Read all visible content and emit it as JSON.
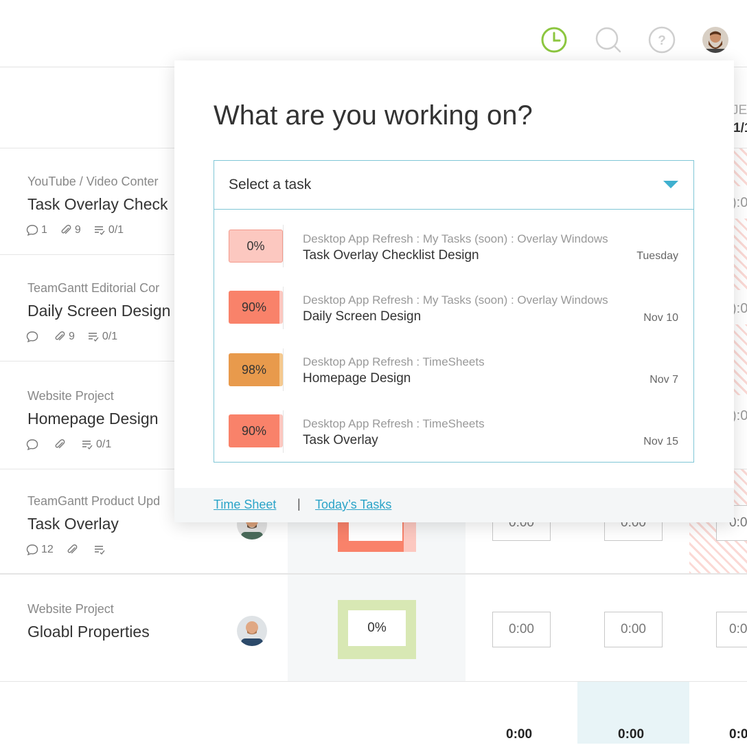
{
  "header": {
    "icons": [
      "clock-icon",
      "search-icon",
      "help-icon"
    ],
    "help_glyph": "?",
    "accent_color": "#8cc63f"
  },
  "rows": [
    {
      "project": "YouTube / Video Conter",
      "title": "Task Overlay Check",
      "comments": "1",
      "attachments": "9",
      "checklist": "0/1"
    },
    {
      "project": "TeamGantt Editorial Cor",
      "title": "Daily Screen Design",
      "comments": "",
      "attachments": "9",
      "checklist": "0/1"
    },
    {
      "project": "Website Project",
      "title": "Homepage Design",
      "comments": "",
      "attachments": "",
      "checklist": "0/1"
    },
    {
      "project": "TeamGantt Product Upd",
      "title": "Task Overlay",
      "comments": "12",
      "attachments": "",
      "checklist": "",
      "progress": "90%",
      "times": [
        "0:00",
        "0:00",
        "0:0"
      ]
    },
    {
      "project": "Website Project",
      "title": "Gloabl Properties",
      "progress": "0%",
      "times": [
        "0:00",
        "0:00",
        "0:0"
      ]
    }
  ],
  "grid_edge": {
    "header_fragment_1": "JE",
    "header_fragment_2": "1/1",
    "cell_fragment": "):0"
  },
  "totals": [
    "0:00",
    "0:00",
    "0:0"
  ],
  "overlay": {
    "title": "What are you working on?",
    "select_placeholder": "Select a task",
    "tasks": [
      {
        "percent": "0%",
        "path": "Desktop App Refresh : My Tasks (soon) : Overlay Windows",
        "name": "Task Overlay Checklist Design",
        "date": "Tuesday",
        "color": "#fcc8c0",
        "border": "#f39a8c"
      },
      {
        "percent": "90%",
        "path": "Desktop App Refresh : My Tasks (soon) : Overlay Windows",
        "name": "Daily Screen Design",
        "date": "Nov 10",
        "color": "#f9826a",
        "border": "#f9826a"
      },
      {
        "percent": "98%",
        "path": "Desktop App Refresh : TimeSheets",
        "name": "Homepage Design",
        "date": "Nov 7",
        "color": "#e89a4c",
        "border": "#e89a4c"
      },
      {
        "percent": "90%",
        "path": "Desktop App Refresh : TimeSheets",
        "name": "Task Overlay",
        "date": "Nov 15",
        "color": "#f9826a",
        "border": "#f9826a"
      }
    ],
    "footer": {
      "time_sheet": "Time Sheet",
      "separator": "|",
      "todays_tasks": "Today’s Tasks"
    }
  }
}
